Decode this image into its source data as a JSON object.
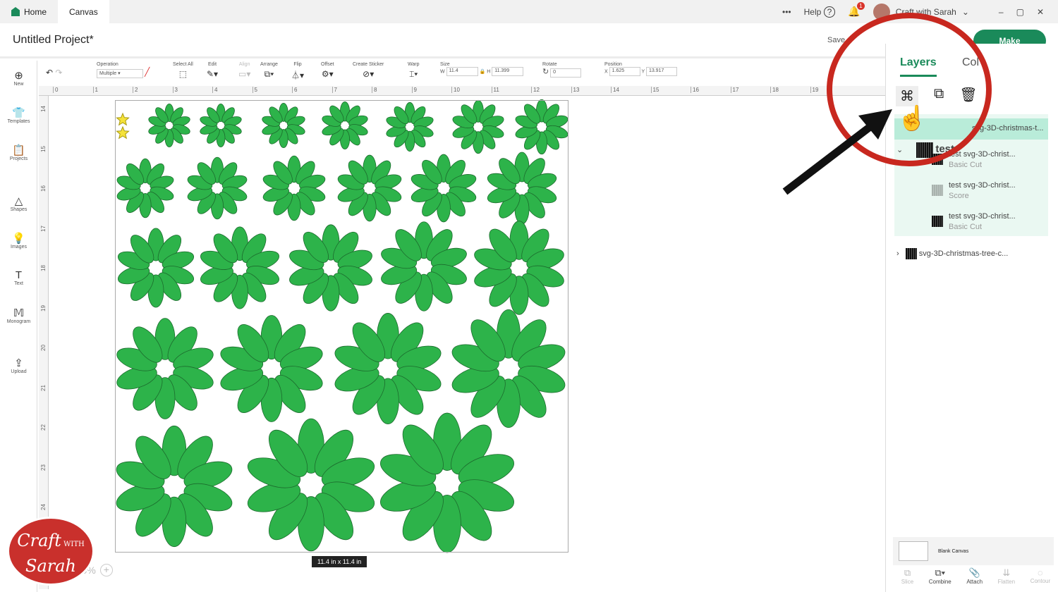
{
  "topbar": {
    "tabs": [
      "Home",
      "Canvas"
    ],
    "more": "•••",
    "help": "Help",
    "notif_count": "1",
    "user": "Craft with Sarah"
  },
  "header": {
    "title": "Untitled Project*",
    "save": "Save",
    "make": "Make"
  },
  "toolbar": {
    "operation_label": "Operation",
    "operation_value": "Multiple",
    "select_all": "Select All",
    "edit": "Edit",
    "align": "Align",
    "arrange": "Arrange",
    "flip": "Flip",
    "offset": "Offset",
    "create_sticker": "Create Sticker",
    "warp": "Warp",
    "size": "Size",
    "w_label": "W",
    "w": "11.4",
    "h_label": "H",
    "h": "11.399",
    "rotate": "Rotate",
    "rotate_value": "0",
    "position": "Position",
    "x_label": "X",
    "x": "1.625",
    "y_label": "Y",
    "y": "13.917"
  },
  "leftbar": [
    "New",
    "Templates",
    "Projects",
    "Shapes",
    "Images",
    "Text",
    "Monogram",
    "Upload"
  ],
  "rulers": {
    "h": [
      "0",
      "1",
      "2",
      "3",
      "4",
      "5",
      "6",
      "7",
      "8",
      "9",
      "10",
      "11",
      "12",
      "13",
      "14",
      "15",
      "16",
      "17",
      "18",
      "19"
    ],
    "v": [
      "14",
      "15",
      "16",
      "17",
      "18",
      "19",
      "20",
      "21",
      "22",
      "23",
      "24"
    ]
  },
  "canvas": {
    "dimensions": "11.4  in x 11.4  in",
    "flower_color": "#2db34a",
    "zoom": "100%"
  },
  "panel": {
    "tabs": [
      "Layers",
      "Col"
    ],
    "layers": [
      {
        "name": "svg-3D-christmas-t...",
        "group": true
      },
      {
        "name": "test",
        "group": true
      },
      {
        "name": "test svg-3D-christ...",
        "op": "Basic Cut"
      },
      {
        "name": "test svg-3D-christ...",
        "op": "Score"
      },
      {
        "name": "test svg-3D-christ...",
        "op": "Basic Cut"
      },
      {
        "name": "svg-3D-christmas-tree-c..."
      }
    ],
    "blank_canvas": "Blank Canvas",
    "actions": [
      "Slice",
      "Combine",
      "Attach",
      "Flatten",
      "Contour"
    ]
  },
  "logo": "Craft with Sarah",
  "accent": "#1a8a5a",
  "highlight": "#c8281f"
}
